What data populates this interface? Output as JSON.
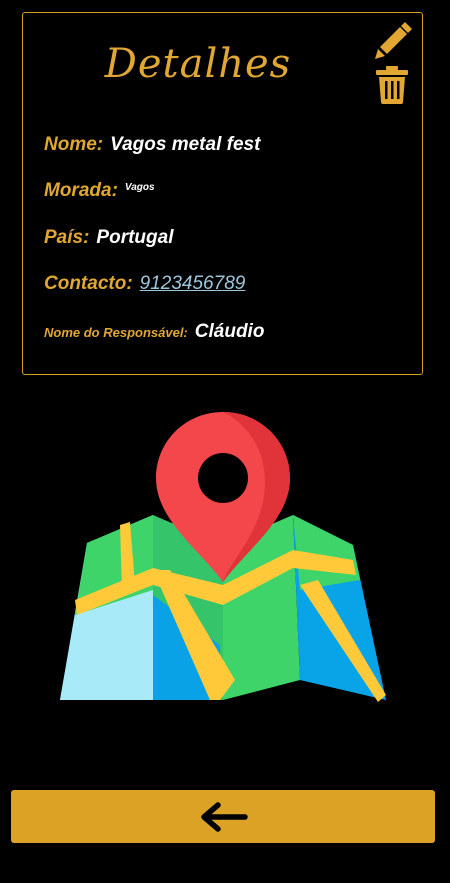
{
  "card": {
    "title": "Detalhes",
    "fields": {
      "nome": {
        "label": "Nome:",
        "value": "Vagos metal fest"
      },
      "morada": {
        "label": "Morada:",
        "value": "Vagos"
      },
      "pais": {
        "label": "País:",
        "value": "Portugal"
      },
      "contacto": {
        "label": "Contacto:",
        "value": "9123456789"
      },
      "responsavel": {
        "label": "Nome do Responsável:",
        "value": "Cláudio"
      }
    }
  },
  "icons": {
    "edit": "pencil-icon",
    "delete": "trash-icon",
    "map": "map-pin-icon",
    "back": "arrow-left-icon"
  },
  "colors": {
    "accent": "#dba226",
    "label": "#e0a733",
    "link": "#9fc6dc",
    "background": "#000000"
  }
}
